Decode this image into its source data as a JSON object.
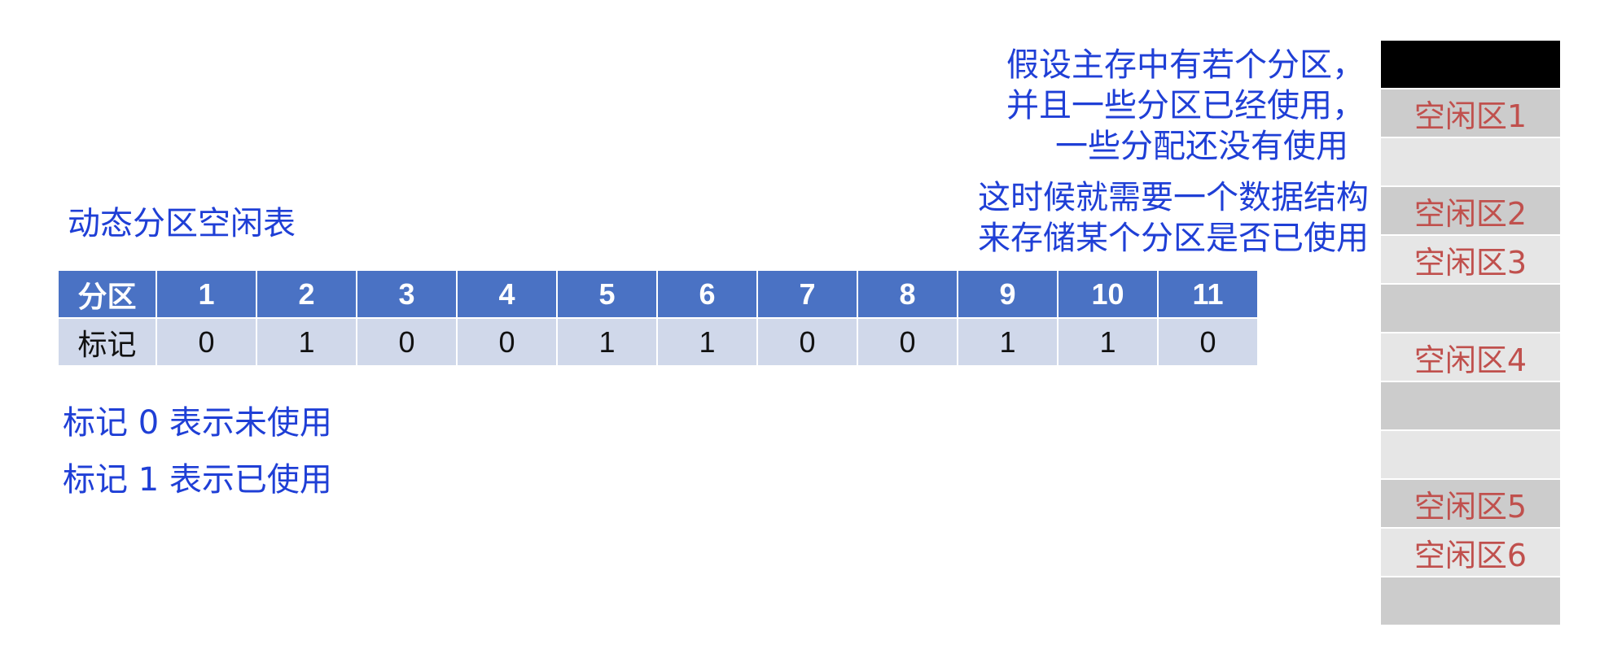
{
  "texts": {
    "table_title": "动态分区空闲表",
    "intro_line1": "假设主存中有若个分区，",
    "intro_line2": "并且一些分区已经使用，",
    "intro_line3": "一些分配还没有使用",
    "need_line1": "这时候就需要一个数据结构",
    "need_line2": "来存储某个分区是否已使用",
    "legend_0": "标记 0 表示未使用",
    "legend_1": "标记 1 表示已使用"
  },
  "table": {
    "header_label": "分区",
    "row_label": "标记",
    "columns": [
      "1",
      "2",
      "3",
      "4",
      "5",
      "6",
      "7",
      "8",
      "9",
      "10",
      "11"
    ],
    "marks": [
      "0",
      "1",
      "0",
      "0",
      "1",
      "1",
      "0",
      "0",
      "1",
      "1",
      "0"
    ]
  },
  "memory_blocks": [
    {
      "label": "",
      "color": "#000000"
    },
    {
      "label": "空闲区1",
      "color": "#cccccc"
    },
    {
      "label": "",
      "color": "#e6e6e6"
    },
    {
      "label": "空闲区2",
      "color": "#cccccc"
    },
    {
      "label": "空闲区3",
      "color": "#e6e6e6"
    },
    {
      "label": "",
      "color": "#cccccc"
    },
    {
      "label": "空闲区4",
      "color": "#e6e6e6"
    },
    {
      "label": "",
      "color": "#cccccc"
    },
    {
      "label": "",
      "color": "#e6e6e6"
    },
    {
      "label": "空闲区5",
      "color": "#cccccc"
    },
    {
      "label": "空闲区6",
      "color": "#e6e6e6"
    },
    {
      "label": "",
      "color": "#cccccc"
    }
  ],
  "colors": {
    "annotation_text": "#1f3fd6",
    "table_header": "#4a72c4",
    "table_body": "#d0d8ea",
    "free_label": "#c0504d"
  }
}
